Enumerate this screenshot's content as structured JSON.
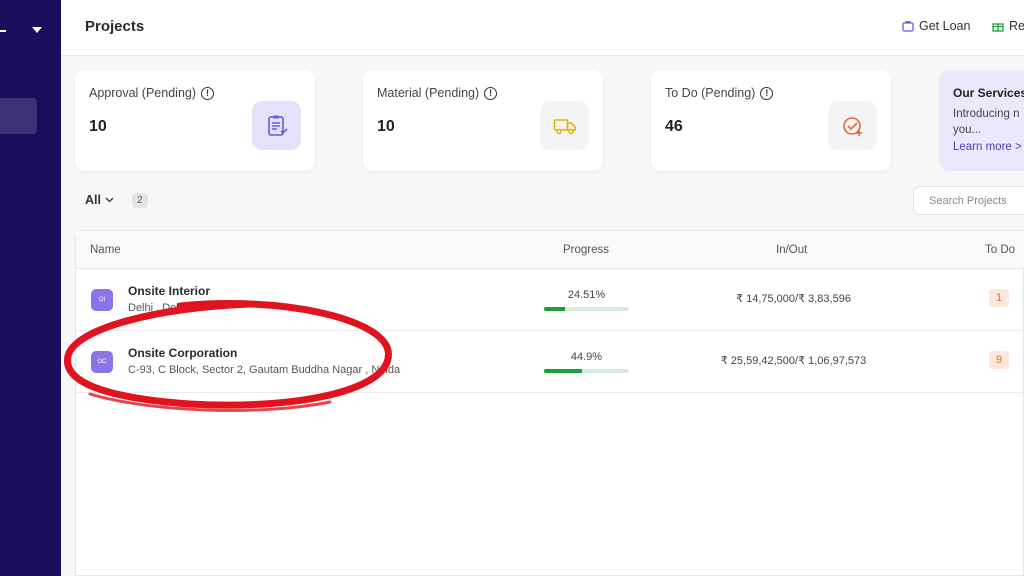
{
  "header": {
    "title": "Projects",
    "get_loan_label": "Get Loan",
    "ref_label": "Ref"
  },
  "cards": [
    {
      "label": "Approval (Pending)",
      "value": "10",
      "icon": "clipboard-icon",
      "icon_bg": "#e4e1fb",
      "icon_color": "#6a5ae0"
    },
    {
      "label": "Material (Pending)",
      "value": "10",
      "icon": "truck-icon",
      "icon_bg": "#f4f4f6",
      "icon_color": "#e0b400"
    },
    {
      "label": "To Do (Pending)",
      "value": "46",
      "icon": "check-plus-icon",
      "icon_bg": "#f4f4f6",
      "icon_color": "#e56a34"
    }
  ],
  "promo": {
    "title": "Our Services",
    "text": "Introducing n you...",
    "link": "Learn more >"
  },
  "filter": {
    "label": "All",
    "count": "2"
  },
  "search": {
    "placeholder": "Search Projects"
  },
  "table": {
    "headers": [
      "Name",
      "Progress",
      "In/Out",
      "To Do"
    ],
    "rows": [
      {
        "initials": "OI",
        "name": "Onsite Interior",
        "address": "Delhi , Delhi",
        "progress_label": "24.51%",
        "progress": 24.51,
        "inout": "₹ 14,75,000/₹ 3,83,596",
        "todo": "1"
      },
      {
        "initials": "OC",
        "name": "Onsite Corporation",
        "address": "C-93, C Block, Sector 2, Gautam Buddha Nagar , Noida",
        "progress_label": "44.9%",
        "progress": 44.9,
        "inout": "₹ 25,59,42,500/₹ 1,06,97,573",
        "todo": "9"
      }
    ]
  },
  "colors": {
    "sidebar": "#1c0e5c",
    "accent": "#4a3fb8",
    "progress": "#1f9d3a",
    "annotation": "#e0141e"
  }
}
